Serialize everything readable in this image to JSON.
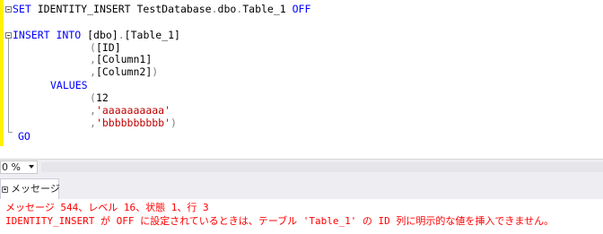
{
  "editor": {
    "lines": [
      {
        "kw1": "SET",
        "t1": " IDENTITY_INSERT TestDatabase",
        "g1": ".",
        "t2": "dbo",
        "g2": ".",
        "t3": "Table_1 ",
        "kw2": "OFF"
      },
      {
        "kw1": "INSERT INTO",
        "t1": " ",
        "t2": "[dbo]",
        "g1": ".",
        "t3": "[Table_1]"
      },
      {
        "g1": "(",
        "t1": "[ID]"
      },
      {
        "g1": ",",
        "t1": "[Column1]"
      },
      {
        "g1": ",",
        "t1": "[Column2]",
        "g2": ")"
      },
      {
        "kw1": "VALUES"
      },
      {
        "g1": "(",
        "t1": "12"
      },
      {
        "g1": ",",
        "s1": "'aaaaaaaaaa'"
      },
      {
        "g1": ",",
        "s1": "'bbbbbbbbbb'",
        "g2": ")"
      },
      {
        "kw1": "GO"
      }
    ]
  },
  "status": {
    "zoom": "0 %"
  },
  "results": {
    "tab_label": "メッセージ",
    "messages": [
      "メッセージ 544、レベル 16、状態 1、行 3",
      "IDENTITY_INSERT が OFF に設定されているときは、テーブル 'Table_1' の ID 列に明示的な値を挿入できません。"
    ]
  },
  "colors": {
    "keyword": "#0000ff",
    "string": "#c00000",
    "operator": "#808080",
    "error": "#ff0000",
    "change_bar": "#fff200"
  }
}
